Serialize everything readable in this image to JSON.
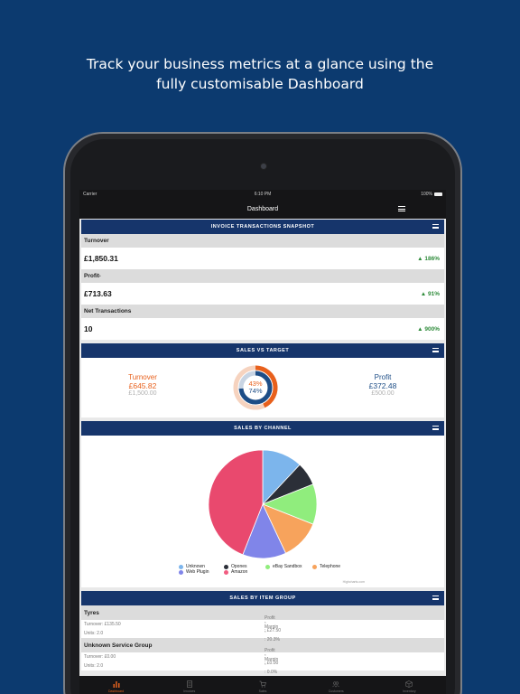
{
  "headline": {
    "line1": "Track your business metrics at a glance using the",
    "line2": "fully customisable Dashboard"
  },
  "status": {
    "carrier": "Carrier",
    "time": "6:10 PM",
    "battery": "100%"
  },
  "nav": {
    "title": "Dashboard"
  },
  "snapshot": {
    "title": "INVOICE TRANSACTIONS SNAPSHOT",
    "metrics": [
      {
        "label": "Turnover",
        "value": "£1,850.31",
        "change": "186%"
      },
      {
        "label": "Profit",
        "value": "£713.63",
        "change": "91%"
      },
      {
        "label": "Net Transactions",
        "value": "10",
        "change": "900%"
      }
    ],
    "profit_sup": "*"
  },
  "sales_vs_target": {
    "title": "SALES VS TARGET",
    "turnover": {
      "label": "Turnover",
      "value": "£645.82",
      "target": "£1,500.00"
    },
    "profit": {
      "label": "Profit",
      "value": "£372.48",
      "target": "£500.00"
    },
    "turnover_pct": "43%",
    "profit_pct": "74%",
    "turnover_fraction": 0.43,
    "profit_fraction": 0.74,
    "turnover_color": "#e8601c",
    "profit_color": "#1d4d86"
  },
  "sales_by_channel": {
    "title": "SALES BY CHANNEL",
    "credits": "Highcharts.com",
    "legend": [
      {
        "name": "Unknown",
        "color": "#7cb5ec"
      },
      {
        "name": "Opones",
        "color": "#2b2f38"
      },
      {
        "name": "eBay Sandbox",
        "color": "#90ed7d"
      },
      {
        "name": "Telephone",
        "color": "#f7a35c"
      },
      {
        "name": "Web Plugin",
        "color": "#8085e9"
      },
      {
        "name": "Amazon",
        "color": "#f15c80"
      }
    ]
  },
  "chart_data": {
    "type": "pie",
    "categories": [
      "Unknown",
      "Opones",
      "eBay Sandbox",
      "Telephone",
      "Web Plugin",
      "Amazon"
    ],
    "values": [
      12,
      7,
      12,
      12,
      13,
      44
    ],
    "colors": [
      "#7cb5ec",
      "#2b2f38",
      "#90ed7d",
      "#f7a35c",
      "#8085e9",
      "#e9496e"
    ]
  },
  "sales_by_item_group": {
    "title": "SALES BY ITEM GROUP",
    "groups": [
      {
        "name": "Tyres",
        "turnover": "Turnover: £135.50",
        "profit": "Profit",
        "profit_value": ": £27.50",
        "units": "Units: 2.0",
        "margin": "Margin",
        "margin_value": ": 20.3%"
      },
      {
        "name": "Unknown Service Group",
        "turnover": "Turnover: £0.00",
        "profit": "Profit",
        "profit_value": ": £0.00",
        "units": "Units: 2.0",
        "margin": "Margin",
        "margin_value": ": 0.0%"
      }
    ]
  },
  "tabs": [
    {
      "label": "Dashboard",
      "icon": "bar-chart-icon",
      "active": true
    },
    {
      "label": "Invoices",
      "icon": "document-icon",
      "active": false
    },
    {
      "label": "Sales",
      "icon": "cart-icon",
      "active": false
    },
    {
      "label": "Customers",
      "icon": "people-icon",
      "active": false
    },
    {
      "label": "Inventory",
      "icon": "box-icon",
      "active": false
    }
  ]
}
